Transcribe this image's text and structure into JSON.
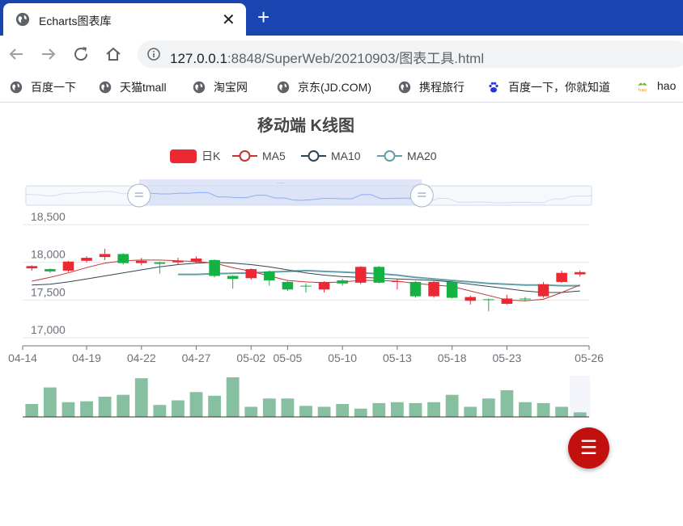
{
  "browser": {
    "tab_title": "Echarts图表库",
    "close_symbol": "✕",
    "new_tab_symbol": "+",
    "url_host": "127.0.0.1",
    "url_path": ":8848/SuperWeb/20210903/图表工具.html",
    "bookmarks": [
      {
        "label": "百度一下",
        "icon": "globe-icon"
      },
      {
        "label": "天猫tmall",
        "icon": "globe-icon"
      },
      {
        "label": "淘宝网",
        "icon": "globe-icon"
      },
      {
        "label": "京东(JD.COM)",
        "icon": "globe-icon"
      },
      {
        "label": "携程旅行",
        "icon": "globe-icon"
      },
      {
        "label": "百度一下，你就知道",
        "icon": "baidu-paw-icon"
      },
      {
        "label": "hao",
        "icon": "hao123-icon"
      }
    ]
  },
  "fab": {
    "symbol": "☰",
    "color": "#c1100e"
  },
  "chart_data": {
    "type": "candlestick",
    "title": "移动端 K线图",
    "legend": [
      {
        "name": "日K",
        "color": "#ec2833"
      },
      {
        "name": "MA5",
        "color": "#c23531"
      },
      {
        "name": "MA10",
        "color": "#2f4554"
      },
      {
        "name": "MA20",
        "color": "#61a0a8"
      }
    ],
    "up_color": "#ec2833",
    "down_color": "#14b143",
    "volume_color": "#87c0a0",
    "y_axis": {
      "ticks": [
        17000,
        17500,
        18000,
        18500
      ],
      "tick_labels": [
        "17,000",
        "17,500",
        "18,000",
        "18,500"
      ],
      "range": [
        17000,
        18500
      ]
    },
    "x_labels": [
      "04-14",
      "04-19",
      "04-22",
      "04-27",
      "05-02",
      "05-05",
      "05-10",
      "05-13",
      "05-18",
      "05-23",
      "05-26"
    ],
    "candles": [
      {
        "o": 17920,
        "c": 17950,
        "l": 17890,
        "h": 17960
      },
      {
        "o": 17910,
        "c": 17880,
        "l": 17860,
        "h": 17920
      },
      {
        "o": 17890,
        "c": 18010,
        "l": 17870,
        "h": 18020
      },
      {
        "o": 18020,
        "c": 18060,
        "l": 18000,
        "h": 18080
      },
      {
        "o": 18070,
        "c": 18110,
        "l": 18030,
        "h": 18180
      },
      {
        "o": 18110,
        "c": 17990,
        "l": 17970,
        "h": 18120
      },
      {
        "o": 17990,
        "c": 18020,
        "l": 17960,
        "h": 18060
      },
      {
        "o": 18000,
        "c": 17980,
        "l": 17850,
        "h": 18010
      },
      {
        "o": 18000,
        "c": 18020,
        "l": 17970,
        "h": 18060
      },
      {
        "o": 18010,
        "c": 18050,
        "l": 17990,
        "h": 18080
      },
      {
        "o": 18030,
        "c": 17820,
        "l": 17800,
        "h": 18040
      },
      {
        "o": 17820,
        "c": 17780,
        "l": 17650,
        "h": 17830
      },
      {
        "o": 17790,
        "c": 17910,
        "l": 17770,
        "h": 17920
      },
      {
        "o": 17880,
        "c": 17760,
        "l": 17690,
        "h": 17890
      },
      {
        "o": 17740,
        "c": 17640,
        "l": 17620,
        "h": 17750
      },
      {
        "o": 17690,
        "c": 17680,
        "l": 17600,
        "h": 17720
      },
      {
        "o": 17640,
        "c": 17740,
        "l": 17600,
        "h": 17750
      },
      {
        "o": 17760,
        "c": 17720,
        "l": 17690,
        "h": 17780
      },
      {
        "o": 17730,
        "c": 17940,
        "l": 17710,
        "h": 17950
      },
      {
        "o": 17940,
        "c": 17730,
        "l": 17720,
        "h": 17950
      },
      {
        "o": 17740,
        "c": 17750,
        "l": 17640,
        "h": 17780
      },
      {
        "o": 17740,
        "c": 17550,
        "l": 17530,
        "h": 17750
      },
      {
        "o": 17550,
        "c": 17740,
        "l": 17530,
        "h": 17750
      },
      {
        "o": 17740,
        "c": 17530,
        "l": 17520,
        "h": 17760
      },
      {
        "o": 17490,
        "c": 17540,
        "l": 17440,
        "h": 17560
      },
      {
        "o": 17510,
        "c": 17500,
        "l": 17350,
        "h": 17520
      },
      {
        "o": 17450,
        "c": 17520,
        "l": 17440,
        "h": 17570
      },
      {
        "o": 17520,
        "c": 17510,
        "l": 17480,
        "h": 17540
      },
      {
        "o": 17550,
        "c": 17710,
        "l": 17530,
        "h": 17740
      },
      {
        "o": 17740,
        "c": 17860,
        "l": 17730,
        "h": 17890
      },
      {
        "o": 17840,
        "c": 17870,
        "l": 17810,
        "h": 17890
      }
    ],
    "ma5": [
      17750,
      17800,
      17860,
      17930,
      17990,
      18020,
      18030,
      18030,
      18020,
      18010,
      17990,
      17930,
      17880,
      17820,
      17760,
      17740,
      17730,
      17740,
      17760,
      17760,
      17750,
      17720,
      17700,
      17680,
      17620,
      17560,
      17500,
      17490,
      17510,
      17600,
      17700
    ],
    "ma10": [
      17700,
      17710,
      17740,
      17780,
      17820,
      17860,
      17900,
      17940,
      17970,
      17990,
      18000,
      17990,
      17970,
      17940,
      17900,
      17860,
      17830,
      17810,
      17800,
      17790,
      17780,
      17770,
      17760,
      17740,
      17710,
      17680,
      17650,
      17620,
      17600,
      17600,
      17620
    ],
    "ma20": [
      null,
      null,
      null,
      null,
      null,
      null,
      null,
      null,
      17840,
      17840,
      17850,
      17855,
      17860,
      17870,
      17880,
      17890,
      17880,
      17870,
      17860,
      17850,
      17830,
      17800,
      17780,
      17760,
      17740,
      17720,
      17710,
      17700,
      17700,
      17690,
      17690
    ],
    "volume": [
      14,
      32,
      16,
      17,
      22,
      24,
      42,
      13,
      18,
      27,
      23,
      43,
      11,
      20,
      20,
      12,
      11,
      14,
      9,
      15,
      16,
      15,
      16,
      24,
      11,
      20,
      29,
      16,
      15,
      11,
      5
    ],
    "data_zoom": {
      "start_percent": 20,
      "end_percent": 70
    }
  }
}
